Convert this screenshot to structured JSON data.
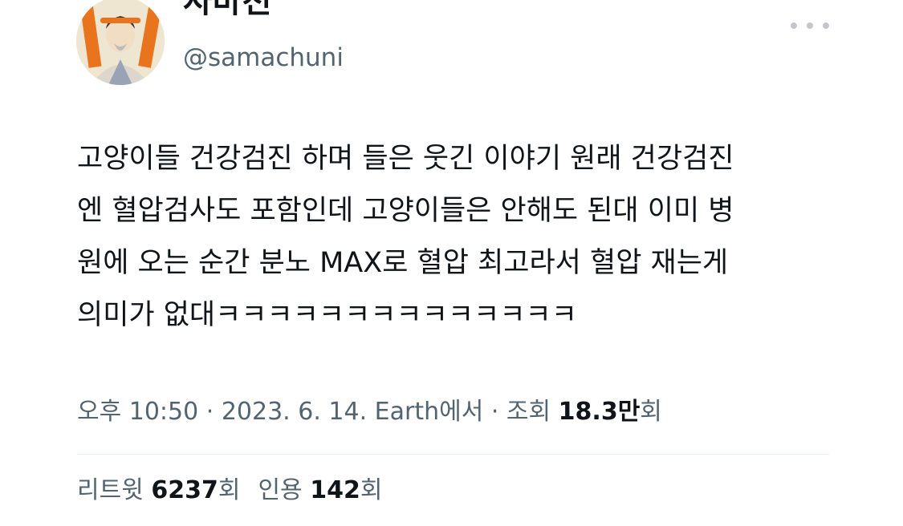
{
  "author": {
    "display_name": "사마천",
    "handle": "@samachuni",
    "avatar_icon": "avatar-portrait-icon"
  },
  "more_icon": "more-dots-icon",
  "tweet": {
    "lines": [
      "고양이들 건강검진 하며 들은 웃긴 이야기 원래 건강검진",
      "엔 혈압검사도 포함인데 고양이들은 안해도 된대 이미 병",
      "원에 오는 순간 분노 MAX로 혈압 최고라서 혈압 재는게",
      "의미가 없대ㅋㅋㅋㅋㅋㅋㅋㅋㅋㅋㅋㅋㅋㅋ"
    ]
  },
  "meta": {
    "time": "오후 10:50",
    "separator": " · ",
    "date": "2023. 6. 14.",
    "source": "Earth에서",
    "views_label": "조회 ",
    "views_value": "18.3만",
    "views_suffix": "회"
  },
  "stats": {
    "retweets_label": "리트윗 ",
    "retweets_value": "6237",
    "retweets_suffix": "회",
    "quotes_label": "인용 ",
    "quotes_value": "142",
    "quotes_suffix": "회"
  },
  "colors": {
    "text": "#0f1419",
    "secondary": "#536471",
    "divider": "#e6ecf0",
    "avatar_accent": "#e8741e"
  }
}
